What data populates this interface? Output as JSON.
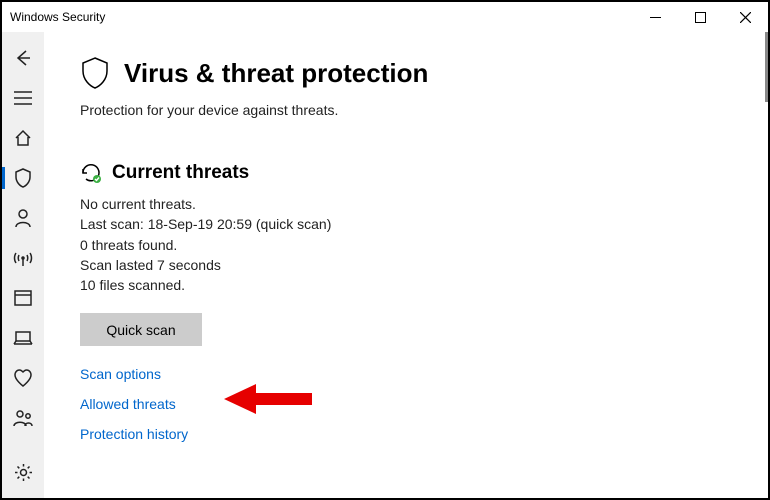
{
  "window": {
    "title": "Windows Security"
  },
  "page": {
    "title": "Virus & threat protection",
    "subtitle": "Protection for your device against threats."
  },
  "current_threats": {
    "heading": "Current threats",
    "status": "No current threats.",
    "last_scan": "Last scan: 18-Sep-19 20:59 (quick scan)",
    "threats_found": "0 threats found.",
    "duration": "Scan lasted 7 seconds",
    "files_scanned": "10 files scanned.",
    "quick_scan_label": "Quick scan"
  },
  "links": {
    "scan_options": "Scan options",
    "allowed_threats": "Allowed threats",
    "protection_history": "Protection history"
  }
}
